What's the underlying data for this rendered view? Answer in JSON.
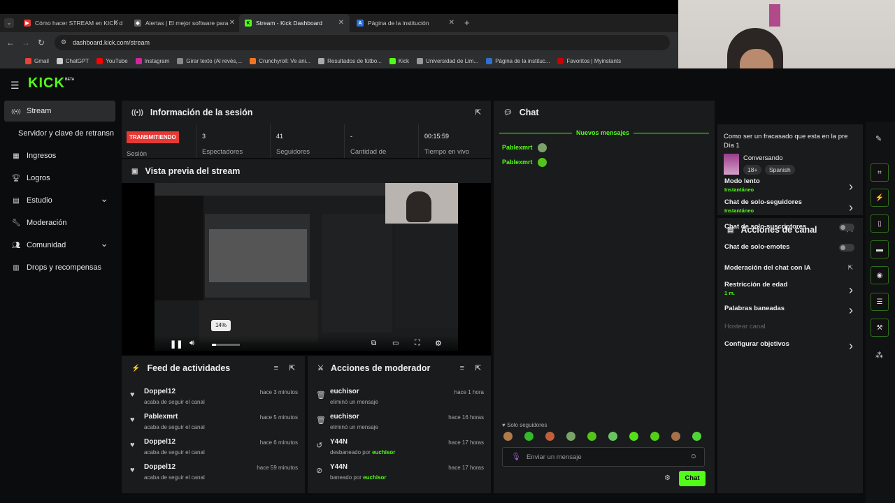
{
  "browser": {
    "tabs": [
      {
        "title": "Cómo hacer STREAM en KICK d",
        "color": "#e53935",
        "active": false
      },
      {
        "title": "Alertas | El mejor software para",
        "color": "#888888",
        "active": false
      },
      {
        "title": "Stream - Kick Dashboard",
        "color": "#53fc18",
        "active": true
      },
      {
        "title": "Página de la institución",
        "color": "#2f6fd1",
        "active": false
      }
    ],
    "url": "dashboard.kick.com/stream",
    "bookmarks": [
      {
        "label": "Gmail",
        "color": "#ea4335"
      },
      {
        "label": "ChatGPT",
        "color": "#cccccc"
      },
      {
        "label": "YouTube",
        "color": "#ff0000"
      },
      {
        "label": "Instagram",
        "color": "#d6249f"
      },
      {
        "label": "Girar texto (Al revés,...",
        "color": "#888888"
      },
      {
        "label": "Crunchyroll: Ve ani...",
        "color": "#f47521"
      },
      {
        "label": "Resultados de fútbo...",
        "color": "#aaaaaa"
      },
      {
        "label": "Kick",
        "color": "#53fc18"
      },
      {
        "label": "Universidad de Lim...",
        "color": "#999999"
      },
      {
        "label": "Página de la instituc...",
        "color": "#2f6fd1"
      },
      {
        "label": "Favoritos | Myinstants",
        "color": "#cc0000"
      }
    ]
  },
  "brand": {
    "logo": "KICK",
    "beta": "BETA",
    "accent": "#53fc18"
  },
  "sidebar": {
    "items": [
      {
        "label": "Stream",
        "icon": "broadcast-icon",
        "active": true
      },
      {
        "label": "Servidor y clave de retransn",
        "icon": "",
        "active": false
      },
      {
        "label": "Ingresos",
        "icon": "chart-icon",
        "active": false
      },
      {
        "label": "Logros",
        "icon": "trophy-icon",
        "active": false
      },
      {
        "label": "Estudio",
        "icon": "studio-icon",
        "active": false,
        "expandable": true
      },
      {
        "label": "Moderación",
        "icon": "wrench-icon",
        "active": false
      },
      {
        "label": "Comunidad",
        "icon": "people-icon",
        "active": false,
        "expandable": true
      },
      {
        "label": "Drops y recompensas",
        "icon": "drops-icon",
        "active": false
      }
    ]
  },
  "session": {
    "title": "Información de la sesión",
    "badge": "TRANSMITIENDO",
    "stats": [
      {
        "value": "",
        "label": "Sesión"
      },
      {
        "value": "3",
        "label": "Espectadores"
      },
      {
        "value": "41",
        "label": "Seguidores"
      },
      {
        "value": "-",
        "label": "Cantidad de"
      },
      {
        "value": "00:15:59",
        "label": "Tiempo en vivo"
      }
    ]
  },
  "preview": {
    "title": "Vista previa del stream",
    "volume_tooltip": "14%"
  },
  "feed": {
    "title": "Feed de actividades",
    "rows": [
      {
        "name": "Doppel12",
        "sub": "acaba de seguir el canal",
        "time": "hace 3 minutos"
      },
      {
        "name": "Pablexmrt",
        "sub": "acaba de seguir el canal",
        "time": "hace 5 minutos"
      },
      {
        "name": "Doppel12",
        "sub": "acaba de seguir el canal",
        "time": "hace 6 minutos"
      },
      {
        "name": "Doppel12",
        "sub": "acaba de seguir el canal",
        "time": "hace 59 minutos"
      }
    ]
  },
  "modactions": {
    "title": "Acciones de moderador",
    "rows": [
      {
        "name": "euchisor",
        "sub": "eliminó un mensaje",
        "by": "",
        "time": "hace 1 hora",
        "icon": "trash-icon"
      },
      {
        "name": "euchisor",
        "sub": "eliminó un mensaje",
        "by": "",
        "time": "hace 16 horas",
        "icon": "trash-icon"
      },
      {
        "name": "Y44N",
        "sub": "desbaneado por",
        "by": "euchisor",
        "time": "hace 17 horas",
        "icon": "undo-icon"
      },
      {
        "name": "Y44N",
        "sub": "baneado por",
        "by": "euchisor",
        "time": "hace 17 horas",
        "icon": "ban-icon"
      }
    ]
  },
  "chat": {
    "title": "Chat",
    "new_messages": "Nuevos mensajes",
    "messages": [
      {
        "user": "Pablexmrt"
      },
      {
        "user": "Pablexmrt"
      }
    ],
    "followers_only": "Solo seguidores",
    "placeholder": "Enviar un mensaje",
    "send": "Chat"
  },
  "stream_info": {
    "title": "Como ser un fracasado que esta en la pre Día 1",
    "category": "Conversando",
    "tags": [
      "18+",
      "Spanish"
    ]
  },
  "channel_actions": {
    "title": "Acciones de canal",
    "items": [
      {
        "label": "Modo lento",
        "sub": "Instantáneo",
        "control": "arrow"
      },
      {
        "label": "Chat de solo-seguidores",
        "sub": "Instantáneo",
        "control": "arrow"
      },
      {
        "label": "Chat de solo-suscriptores",
        "sub": "",
        "control": "toggle"
      },
      {
        "label": "Chat de solo-emotes",
        "sub": "",
        "control": "toggle"
      },
      {
        "label": "Moderación del chat con IA",
        "sub": "",
        "control": "external"
      },
      {
        "label": "Restricción de edad",
        "sub": "1 m.",
        "control": "arrow"
      },
      {
        "label": "Palabras baneadas",
        "sub": "",
        "control": "arrow"
      },
      {
        "label": "Hostear canal",
        "sub": "",
        "control": "disabled"
      },
      {
        "label": "Configurar objetivos",
        "sub": "",
        "control": "arrow"
      }
    ]
  }
}
